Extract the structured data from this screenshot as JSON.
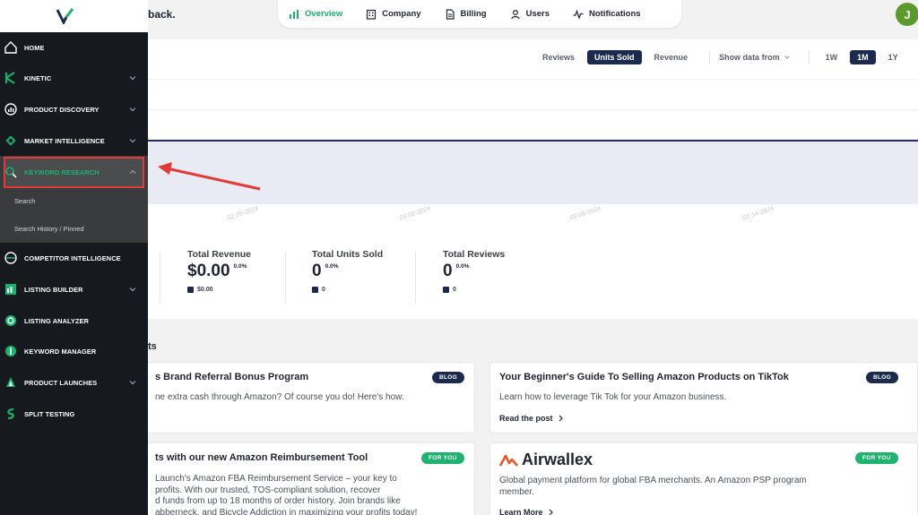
{
  "header": {
    "welcome_text": "back.",
    "nav": [
      {
        "label": "Overview",
        "icon": "bar-chart-icon"
      },
      {
        "label": "Company",
        "icon": "building-icon"
      },
      {
        "label": "Billing",
        "icon": "document-icon"
      },
      {
        "label": "Users",
        "icon": "user-icon"
      },
      {
        "label": "Notifications",
        "icon": "pulse-icon"
      }
    ],
    "avatar_initial": "J"
  },
  "sidebar": {
    "items": [
      {
        "label": "HOME",
        "icon": "home-icon"
      },
      {
        "label": "KINETIC",
        "icon": "kinetic-icon"
      },
      {
        "label": "PRODUCT DISCOVERY",
        "icon": "discovery-icon"
      },
      {
        "label": "MARKET INTELLIGENCE",
        "icon": "market-icon"
      },
      {
        "label": "KEYWORD RESEARCH",
        "icon": "keyword-search-icon"
      },
      {
        "label": "COMPETITOR INTELLIGENCE",
        "icon": "competitor-icon"
      },
      {
        "label": "LISTING BUILDER",
        "icon": "listing-builder-icon"
      },
      {
        "label": "LISTING ANALYZER",
        "icon": "listing-analyzer-icon"
      },
      {
        "label": "KEYWORD MANAGER",
        "icon": "keyword-manager-icon"
      },
      {
        "label": "PRODUCT LAUNCHES",
        "icon": "launch-icon"
      },
      {
        "label": "SPLIT TESTING",
        "icon": "split-testing-icon"
      }
    ],
    "subitems": [
      "Search",
      "Search History / Pinned"
    ]
  },
  "chart": {
    "tabs": [
      "Reviews",
      "Units Sold",
      "Revenue"
    ],
    "active_tab": "Units Sold",
    "filter_label": "Show data from",
    "ranges": [
      "1W",
      "1M",
      "1Y"
    ],
    "active_range": "1M",
    "x_ticks": [
      "02-25-2024",
      "03-02-2024",
      "03-08-2024",
      "03-14-2024"
    ]
  },
  "stats": [
    {
      "title": "Total Revenue",
      "value": "$0.00",
      "pct": "0.0%",
      "legend": "$0.00"
    },
    {
      "title": "Total Units Sold",
      "value": "0",
      "pct": "0.0%",
      "legend": "0"
    },
    {
      "title": "Total Reviews",
      "value": "0",
      "pct": "0.0%",
      "legend": "0"
    }
  ],
  "section_heading": "ts",
  "cards": [
    {
      "title": "s Brand Referral Bonus Program",
      "desc": "ne extra cash through Amazon? Of course you do! Here's how.",
      "badge": "BLOG"
    },
    {
      "title": "Your Beginner's Guide To Selling Amazon Products on TikTok",
      "desc": "Learn how to leverage Tik Tok for your Amazon business.",
      "link": "Read the post",
      "badge": "BLOG"
    },
    {
      "title": "ts with our new Amazon Reimbursement Tool",
      "desc_lines": [
        "Launch's Amazon FBA Reimbursement Service – your key to",
        "profits. With our trusted, TOS-compliant solution, recover",
        "d funds from up to 18 months of order history. Join brands like",
        "abberneck, and Bicycle Addiction in maximizing your profits today!"
      ],
      "badge": "FOR YOU"
    },
    {
      "brand": "Airwallex",
      "desc_lines": [
        "Global payment platform for global FBA merchants. An Amazon PSP program",
        "member."
      ],
      "link": "Learn More",
      "badge": "FOR YOU"
    }
  ],
  "colors": {
    "accent_green": "#19b26b",
    "navy": "#1b2a4e",
    "sidebar_bg": "#16191e",
    "highlight_red": "#e53935"
  }
}
